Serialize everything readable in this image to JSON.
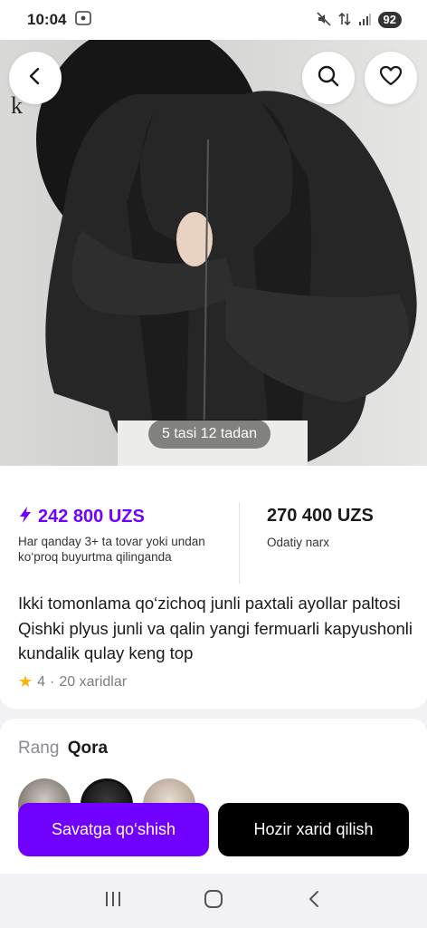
{
  "status_bar": {
    "time": "10:04",
    "battery": "92",
    "icons": [
      "screenshot-icon",
      "mute-icon",
      "data-icon",
      "signal-icon",
      "battery-icon"
    ]
  },
  "header": {
    "brand_text": "k",
    "image_counter": "5 tasi 12 tadan",
    "icons": [
      "back-arrow-icon",
      "search-icon",
      "heart-icon"
    ]
  },
  "pricing": {
    "promo_price": "242 800 UZS",
    "promo_note": "Har qanday 3+ ta tovar yoki undan ko‘proq buyurtma qilinganda",
    "regular_price": "270 400 UZS",
    "regular_note": "Odatiy narx",
    "promo_icon": "lightning-icon"
  },
  "product": {
    "title": "Ikki tomonlama qo‘zichoq junli paxtali ayollar paltosi Qishki plyus junli va qalin yangi fermuarli kapyushonli kundalik qulay keng top",
    "rating": "4",
    "separator": "·",
    "purchases": "20 xaridlar"
  },
  "variants": {
    "label": "Rang",
    "selected": "Qora"
  },
  "actions": {
    "add_to_cart": "Savatga qo‘shish",
    "buy_now": "Hozir xarid qilish"
  },
  "colors": {
    "accent": "#7000ff",
    "star": "#ffb200",
    "buy_button": "#000000"
  }
}
